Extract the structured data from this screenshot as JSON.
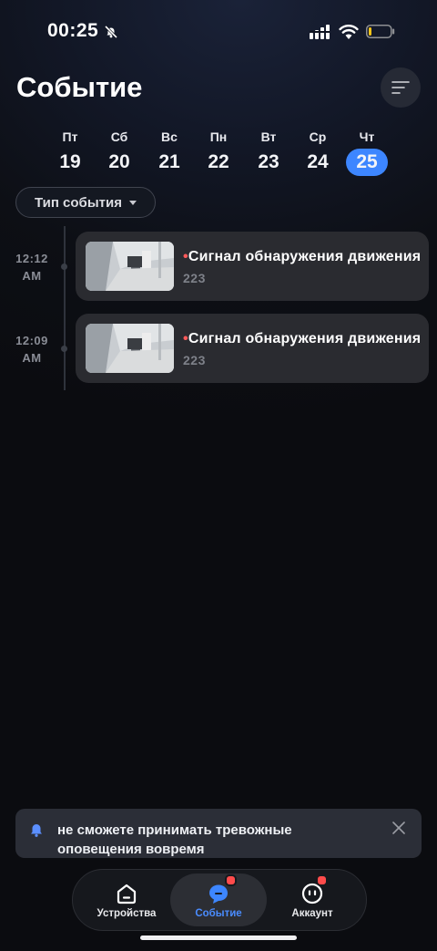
{
  "status_bar": {
    "time": "00:25",
    "silent_icon": "bell-slash-icon",
    "signal_icon": "cellular-signal-icon",
    "wifi_icon": "wifi-icon",
    "battery_icon": "battery-low-icon",
    "battery_level": 0.1,
    "battery_color": "#f5c518"
  },
  "header": {
    "title": "Событие",
    "filter_icon": "sort-lines-icon"
  },
  "dates": [
    {
      "dow": "Пт",
      "day": "19"
    },
    {
      "dow": "Сб",
      "day": "20"
    },
    {
      "dow": "Вс",
      "day": "21"
    },
    {
      "dow": "Пн",
      "day": "22"
    },
    {
      "dow": "Вт",
      "day": "23"
    },
    {
      "dow": "Ср",
      "day": "24"
    },
    {
      "dow": "Чт",
      "day": "25"
    }
  ],
  "selected_date": "25",
  "accent_color": "#3d86ff",
  "filter_chip": {
    "label": "Тип события",
    "icon": "caret-down-icon"
  },
  "events": [
    {
      "time": "12:12",
      "period": "AM",
      "dot": "•",
      "title": "Сигнал обнаружения движения",
      "device": "223"
    },
    {
      "time": "12:09",
      "period": "AM",
      "dot": "•",
      "title": "Сигнал обнаружения движения",
      "device": "223"
    }
  ],
  "toast": {
    "icon": "bell-icon",
    "text": "не сможете принимать тревожные оповещения вовремя",
    "close_icon": "close-icon"
  },
  "tabbar": {
    "tabs": [
      {
        "label": "Устройства",
        "icon": "home-icon",
        "active": false,
        "badge": false
      },
      {
        "label": "Событие",
        "icon": "chat-bubble-icon",
        "active": true,
        "badge": true
      },
      {
        "label": "Аккаунт",
        "icon": "user-face-icon",
        "active": false,
        "badge": true
      }
    ]
  }
}
